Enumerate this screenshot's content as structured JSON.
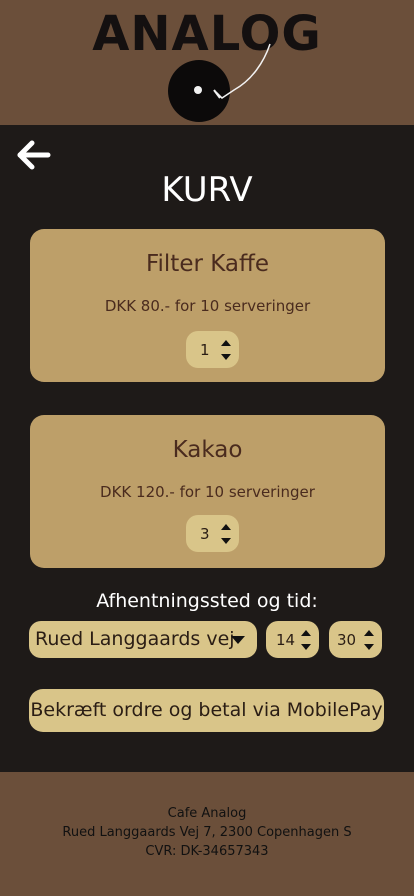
{
  "header": {
    "logo_text": "ANALOG",
    "logo_icon": "record-player-icon"
  },
  "nav": {
    "back_icon": "arrow-left-icon"
  },
  "page": {
    "title": "KURV"
  },
  "cart": {
    "items": [
      {
        "name": "Filter Kaffe",
        "description": "DKK 80.- for 10 serveringer",
        "quantity": "1"
      },
      {
        "name": "Kakao",
        "description": "DKK 120.- for 10 serveringer",
        "quantity": "3"
      }
    ]
  },
  "pickup": {
    "label": "Afhentningssted og tid:",
    "location": "Rued Langgaards vej",
    "hour": "14",
    "minute": "30"
  },
  "actions": {
    "confirm_label": "Bekræft ordre og betal via MobilePay"
  },
  "footer": {
    "name": "Cafe Analog",
    "address": "Rued Langgaards Vej 7, 2300 Copenhagen S",
    "cvr": "CVR: DK-34657343"
  },
  "colors": {
    "header_bg": "#6b4f3a",
    "body_bg": "#1e1a18",
    "card_bg": "#bd9f69",
    "control_bg": "#d9c589",
    "text_dark": "#4a2b1e"
  }
}
